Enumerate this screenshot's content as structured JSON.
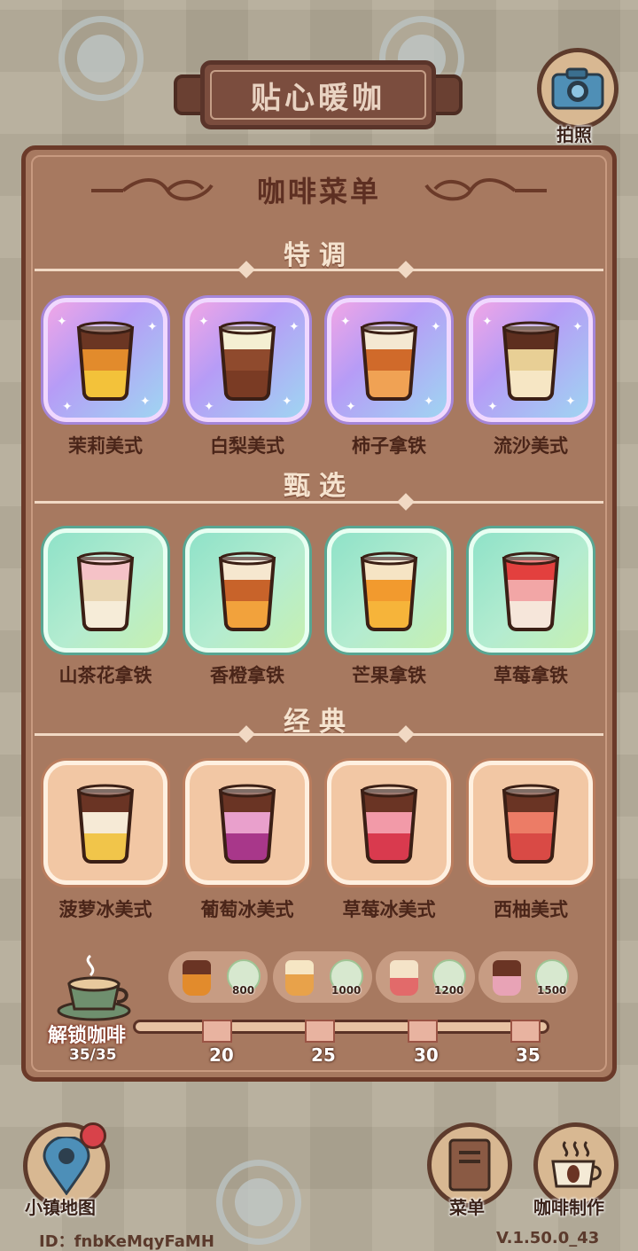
{
  "header": {
    "title": "贴心暖咖",
    "camera_label": "拍照"
  },
  "menu": {
    "title": "咖啡菜单",
    "sections": [
      {
        "name": "特调",
        "style": "special",
        "items": [
          {
            "name": "茉莉美式",
            "layers": [
              "#f3c23a",
              "#e28b2c",
              "#6b3623"
            ]
          },
          {
            "name": "白梨美式",
            "layers": [
              "#7a3b24",
              "#8f4a2d",
              "#f4efd2"
            ]
          },
          {
            "name": "柿子拿铁",
            "layers": [
              "#f0a254",
              "#d06a2a",
              "#f4e8d2"
            ]
          },
          {
            "name": "流沙美式",
            "layers": [
              "#f6e6c4",
              "#e8cf95",
              "#5e2f1f"
            ]
          }
        ]
      },
      {
        "name": "甄选",
        "style": "select",
        "items": [
          {
            "name": "山茶花拿铁",
            "layers": [
              "#f6ecd8",
              "#e9d6b3",
              "#f5c2c7"
            ]
          },
          {
            "name": "香橙拿铁",
            "layers": [
              "#f2a23c",
              "#c8632a",
              "#f6e7cf"
            ]
          },
          {
            "name": "芒果拿铁",
            "layers": [
              "#f6b43a",
              "#f29a2e",
              "#f6e4c4"
            ]
          },
          {
            "name": "草莓拿铁",
            "layers": [
              "#f6e6da",
              "#f2a6a6",
              "#e3403e"
            ]
          }
        ]
      },
      {
        "name": "经典",
        "style": "classic",
        "items": [
          {
            "name": "菠萝冰美式",
            "layers": [
              "#f1c54a",
              "#f6ead6",
              "#6a3424"
            ]
          },
          {
            "name": "葡萄冰美式",
            "layers": [
              "#a8378a",
              "#e9a0cc",
              "#6a3424"
            ]
          },
          {
            "name": "草莓冰美式",
            "layers": [
              "#d93a4e",
              "#f29aa8",
              "#6a3424"
            ]
          },
          {
            "name": "西柚美式",
            "layers": [
              "#d94a45",
              "#ec7c66",
              "#6a3424"
            ]
          }
        ]
      }
    ]
  },
  "unlock": {
    "label": "解锁咖啡",
    "count": "35/35",
    "rewards": [
      "800",
      "1000",
      "1200",
      "1500"
    ],
    "milestones": [
      "20",
      "25",
      "30",
      "35"
    ]
  },
  "bottom_nav": {
    "map_label": "小镇地图",
    "menu_label": "菜单",
    "make_label": "咖啡制作"
  },
  "footer": {
    "user_id": "ID：fnbKeMqyFaMH",
    "version": "V.1.50.0_43"
  },
  "colors": {
    "panel": "#a77960",
    "border": "#6b3a29",
    "accent_text": "#5d2f22"
  }
}
